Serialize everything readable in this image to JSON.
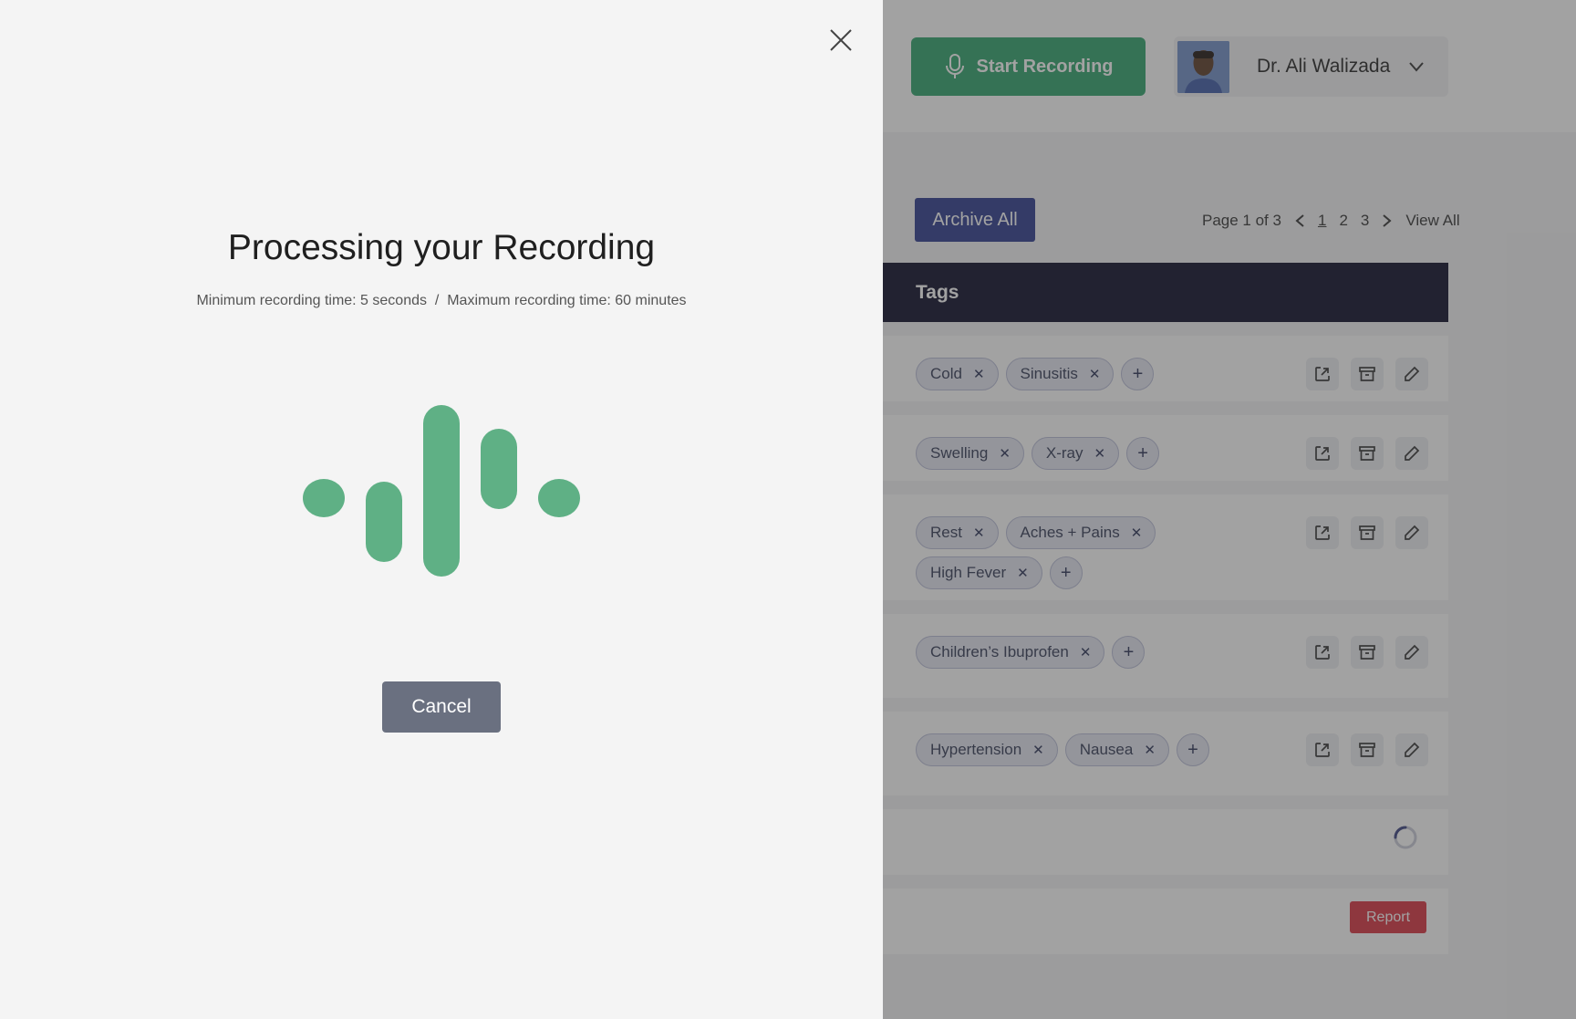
{
  "header": {
    "record_label": "Start Recording",
    "user_name": "Dr. Ali Walizada"
  },
  "toolbar": {
    "archive_label": "Archive All",
    "page_info": "Page 1 of 3",
    "pages": [
      "1",
      "2",
      "3"
    ],
    "view_all": "View All"
  },
  "table": {
    "header": "Tags",
    "rows": [
      {
        "tags": [
          "Cold",
          "Sinusitis"
        ]
      },
      {
        "tags": [
          "Swelling",
          "X-ray"
        ]
      },
      {
        "tags": [
          "Rest",
          "Aches + Pains",
          "High Fever"
        ]
      },
      {
        "tags": [
          "Children’s Ibuprofen"
        ]
      },
      {
        "tags": [
          "Hypertension",
          "Nausea"
        ]
      }
    ],
    "report_label": "Report"
  },
  "modal": {
    "title": "Processing your Recording",
    "subtitle": "Minimum recording time: 5 seconds  /  Maximum recording time: 60 minutes",
    "cancel_label": "Cancel"
  },
  "colors": {
    "accent_green": "#2ea36b",
    "wave_green": "#5fb085",
    "archive_blue": "#2c3a8f",
    "table_header": "#0a0a28",
    "report_red": "#d93240",
    "cancel_gray": "#6a7080"
  }
}
